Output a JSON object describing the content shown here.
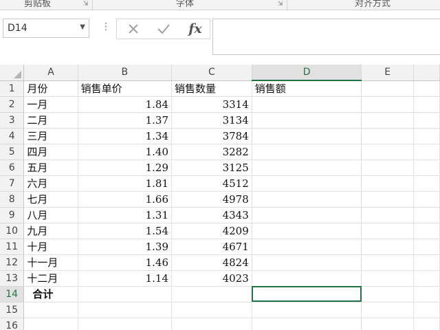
{
  "ribbon": {
    "groups": [
      "剪贴板",
      "字体",
      "对齐方式"
    ]
  },
  "formula_bar": {
    "name_box": "D14",
    "fx_label": "fx",
    "formula": ""
  },
  "icons": {
    "cancel": "close-icon",
    "enter": "check-icon",
    "function": "fx-icon",
    "more": "kebab-icon",
    "dropdown": "chevron-down-icon"
  },
  "colors": {
    "accent": "#217346",
    "header_bg": "#f2f2f2",
    "gridline": "#e0e0e0"
  },
  "grid": {
    "columns": [
      "A",
      "B",
      "C",
      "D",
      "E"
    ],
    "active_cell": "D14",
    "rows": [
      {
        "num": "1",
        "A": "月份",
        "B": "销售单价",
        "C": "销售数量",
        "D": "销售额",
        "E": ""
      },
      {
        "num": "2",
        "A": "一月",
        "B": "1.84",
        "C": "3314",
        "D": "",
        "E": ""
      },
      {
        "num": "3",
        "A": "二月",
        "B": "1.37",
        "C": "3134",
        "D": "",
        "E": ""
      },
      {
        "num": "4",
        "A": "三月",
        "B": "1.34",
        "C": "3784",
        "D": "",
        "E": ""
      },
      {
        "num": "5",
        "A": "四月",
        "B": "1.40",
        "C": "3282",
        "D": "",
        "E": ""
      },
      {
        "num": "6",
        "A": "五月",
        "B": "1.29",
        "C": "3125",
        "D": "",
        "E": ""
      },
      {
        "num": "7",
        "A": "六月",
        "B": "1.81",
        "C": "4512",
        "D": "",
        "E": ""
      },
      {
        "num": "8",
        "A": "七月",
        "B": "1.66",
        "C": "4978",
        "D": "",
        "E": ""
      },
      {
        "num": "9",
        "A": "八月",
        "B": "1.31",
        "C": "4343",
        "D": "",
        "E": ""
      },
      {
        "num": "10",
        "A": "九月",
        "B": "1.54",
        "C": "4209",
        "D": "",
        "E": ""
      },
      {
        "num": "11",
        "A": "十月",
        "B": "1.39",
        "C": "4671",
        "D": "",
        "E": ""
      },
      {
        "num": "12",
        "A": "十一月",
        "B": "1.46",
        "C": "4824",
        "D": "",
        "E": ""
      },
      {
        "num": "13",
        "A": "十二月",
        "B": "1.14",
        "C": "4023",
        "D": "",
        "E": ""
      },
      {
        "num": "14",
        "A": "合计",
        "B": "",
        "C": "",
        "D": "",
        "E": ""
      },
      {
        "num": "15",
        "A": "",
        "B": "",
        "C": "",
        "D": "",
        "E": ""
      },
      {
        "num": "16",
        "A": "",
        "B": "",
        "C": "",
        "D": "",
        "E": ""
      }
    ]
  }
}
